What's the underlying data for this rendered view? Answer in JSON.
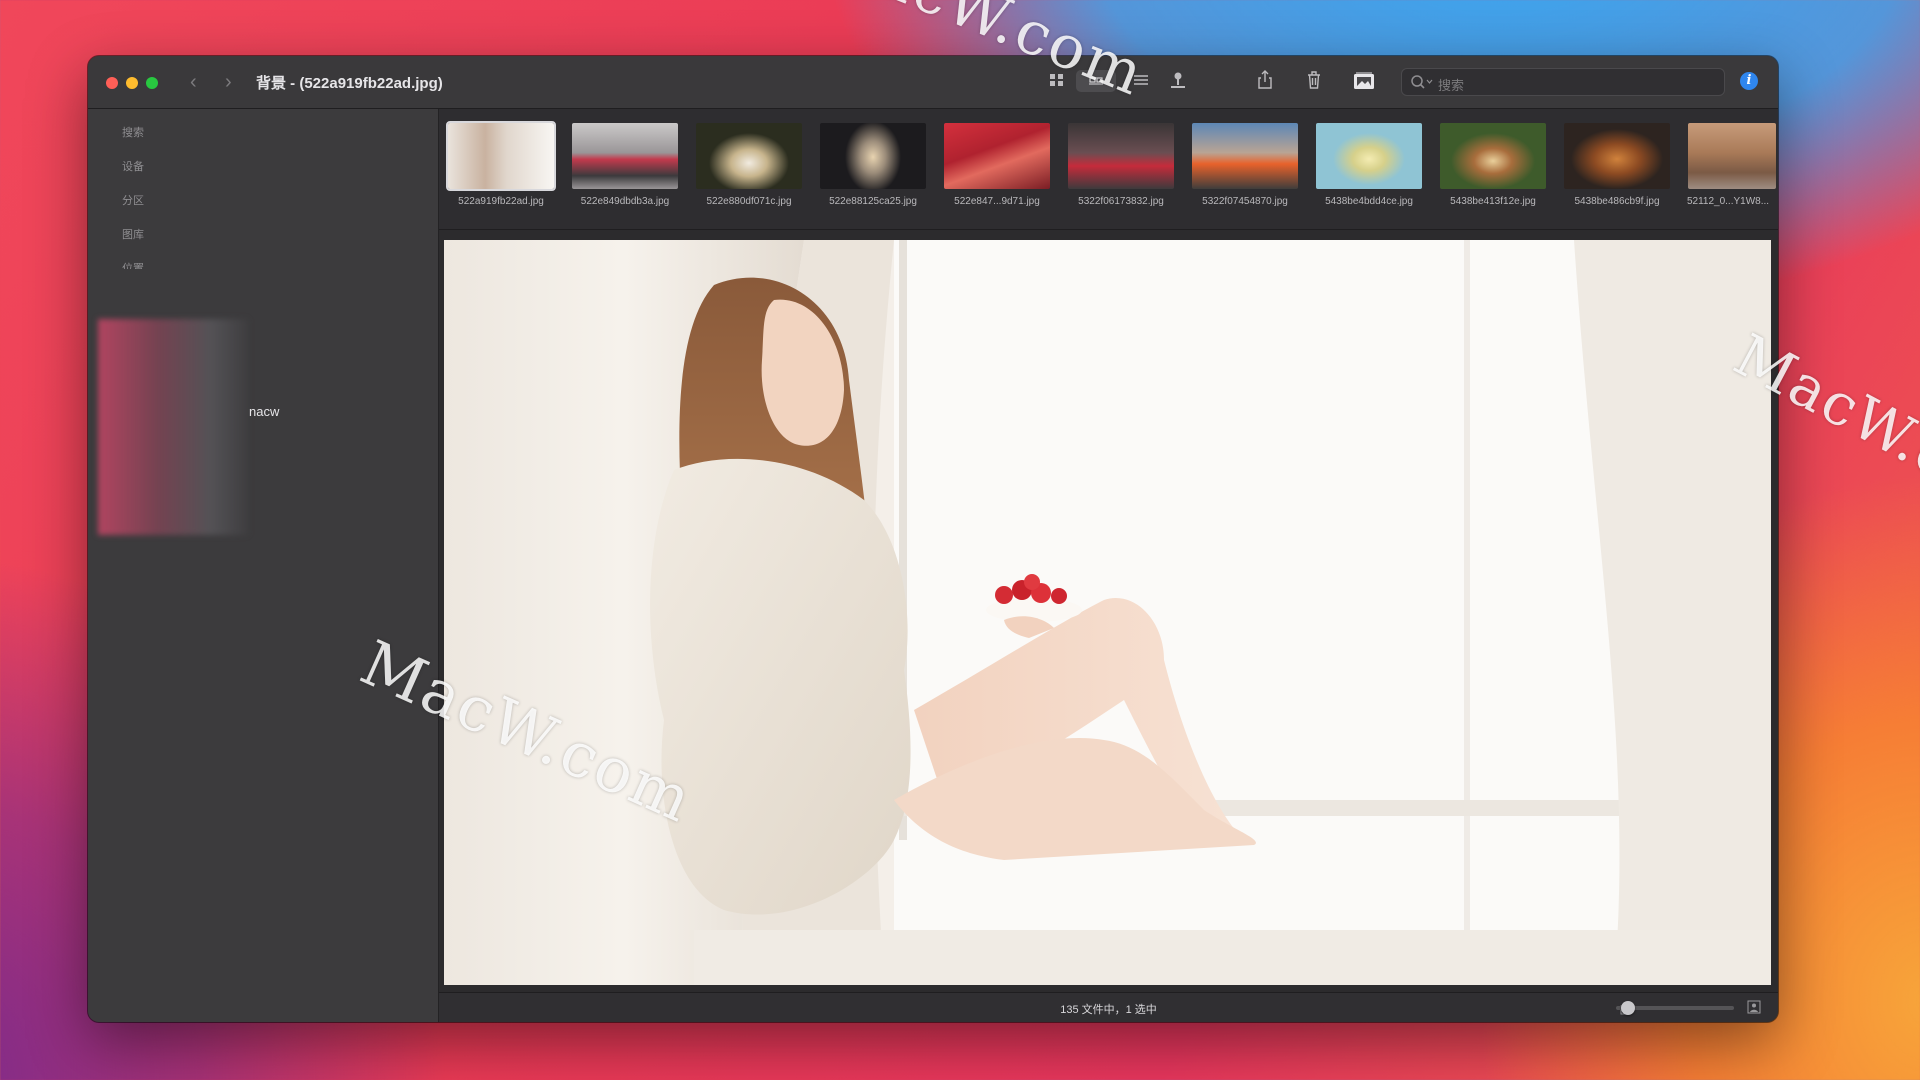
{
  "window": {
    "title": "背景 - (522a919fb22ad.jpg)"
  },
  "toolbar": {
    "icons": [
      "back-icon",
      "forward-icon",
      "grid-view-icon",
      "filmstrip-view-icon",
      "list-view-icon",
      "upload-icon",
      "share-icon",
      "trash-icon",
      "slideshow-icon",
      "info-icon"
    ],
    "search_placeholder": "搜索",
    "back_glyph": "‹",
    "forward_glyph": "›",
    "info_glyph": "i"
  },
  "sidebar": {
    "sections": [
      "搜索",
      "设备",
      "分区",
      "图库",
      "位置"
    ],
    "item_label": "nacw"
  },
  "thumbnails": [
    {
      "name": "522a919fb22ad.jpg",
      "selected": true
    },
    {
      "name": "522e849dbdb3a.jpg",
      "selected": false
    },
    {
      "name": "522e880df071c.jpg",
      "selected": false
    },
    {
      "name": "522e88125ca25.jpg",
      "selected": false
    },
    {
      "name": "522e847...9d71.jpg",
      "selected": false
    },
    {
      "name": "5322f06173832.jpg",
      "selected": false
    },
    {
      "name": "5322f07454870.jpg",
      "selected": false
    },
    {
      "name": "5438be4bdd4ce.jpg",
      "selected": false
    },
    {
      "name": "5438be413f12e.jpg",
      "selected": false
    },
    {
      "name": "5438be486cb9f.jpg",
      "selected": false
    },
    {
      "name": "52112_0...Y1W8...",
      "selected": false
    }
  ],
  "status": {
    "text": "135 文件中，1 选中",
    "zoom_fraction": 0.05
  },
  "watermark": "MacW.com",
  "colors": {
    "accent": "#2f86ee",
    "close": "#ff5f57",
    "minimize": "#febc2e",
    "zoom": "#28c840"
  }
}
